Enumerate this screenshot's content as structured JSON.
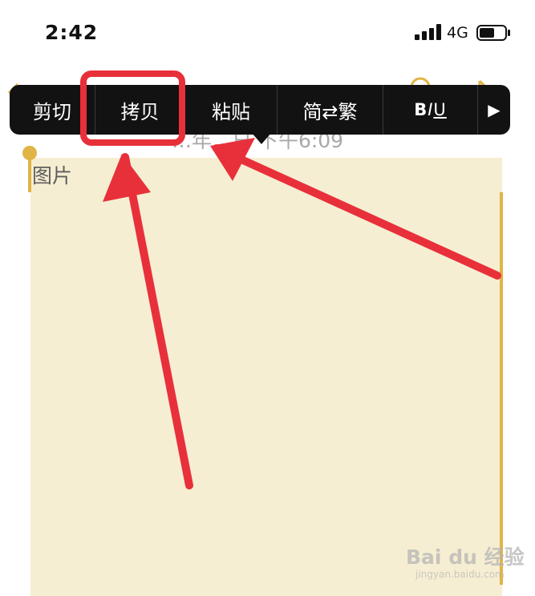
{
  "status_bar": {
    "time": "2:42",
    "network": "4G",
    "battery_level": 0.6
  },
  "document": {
    "date_line": "…年…日 下午6:09",
    "first_line": "图片",
    "highlight_color": "#f6eed2",
    "handle_color": "#e0b445"
  },
  "edit_menu": {
    "items": [
      {
        "label": "剪切"
      },
      {
        "label": "拷贝"
      },
      {
        "label": "粘贴"
      },
      {
        "label": "简⇄繁"
      },
      {
        "label_b": "B",
        "label_i": "I",
        "label_u": "U"
      },
      {
        "label": "▶"
      }
    ],
    "background_color": "#121212"
  },
  "annotation": {
    "highlighted_item": "拷贝",
    "color": "#e8303a"
  },
  "watermark": {
    "text": "Bai du 经验",
    "sub": "jingyan.baidu.com"
  }
}
